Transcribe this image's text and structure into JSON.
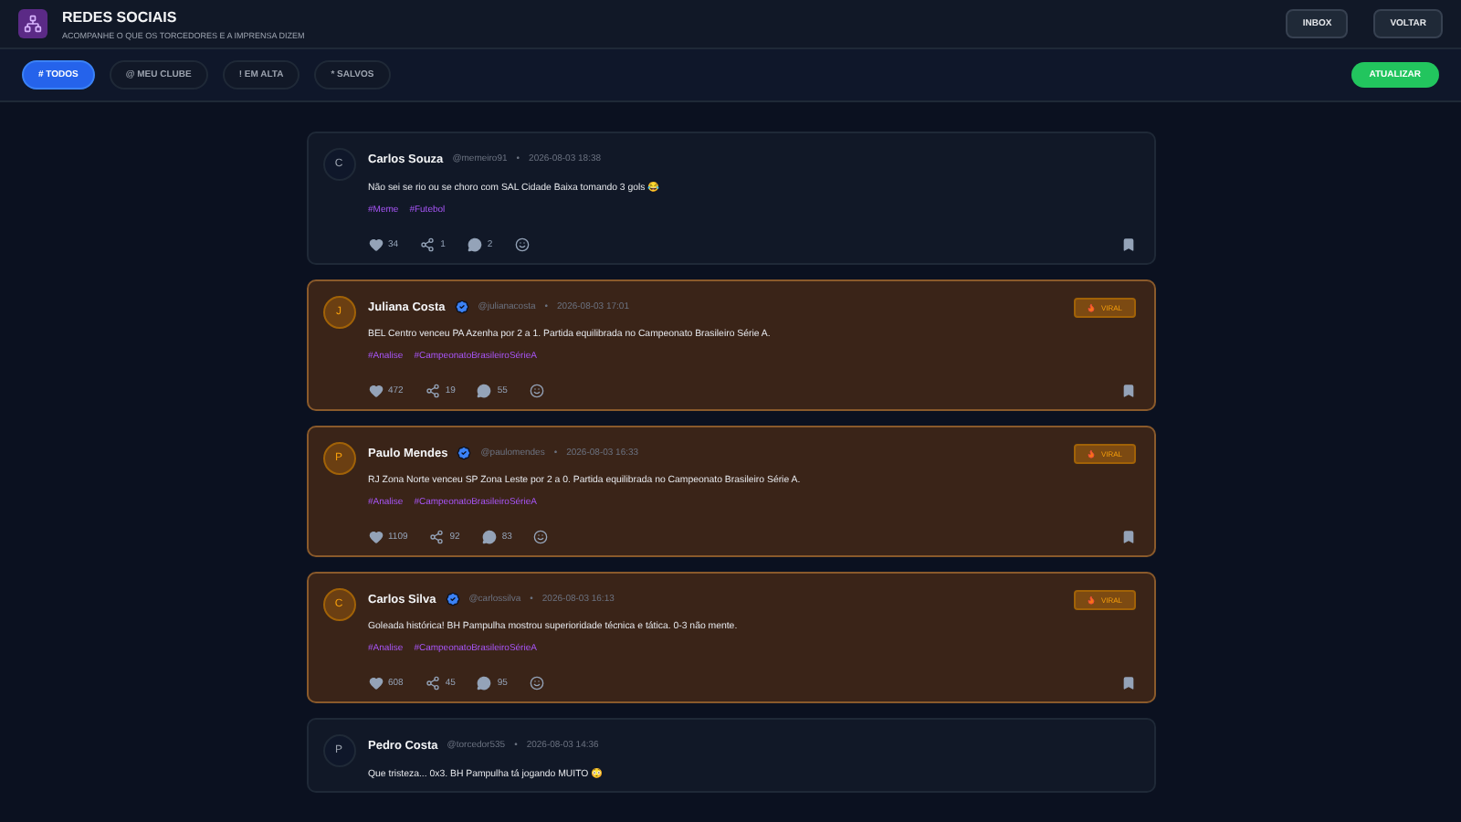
{
  "header": {
    "title": "REDES SOCIAIS",
    "subtitle": "ACOMPANHE O QUE OS TORCEDORES E A IMPRENSA DIZEM",
    "buttons": [
      "INBOX",
      "VOLTAR"
    ]
  },
  "filters": [
    {
      "label": "# TODOS",
      "selected": true
    },
    {
      "label": "@ MEU CLUBE",
      "selected": false
    },
    {
      "label": "! EM ALTA",
      "selected": false
    },
    {
      "label": "* SALVOS",
      "selected": false
    }
  ],
  "refresh_button": "ATUALIZAR",
  "posts": [
    {
      "avatar": "C",
      "name": "Carlos Souza",
      "verified": false,
      "handle": "@memeiro91",
      "separator": "•",
      "time": "2026-08-03 18:38",
      "viral": false,
      "text": "Não sei se rio ou se choro com SAL Cidade Baixa tomando 3 gols 😂",
      "tags": [
        "#Meme",
        "#Futebol"
      ],
      "likes": "34",
      "shares": "1",
      "comments": "2"
    },
    {
      "avatar": "J",
      "name": "Juliana Costa",
      "verified": true,
      "handle": "@julianacosta",
      "separator": "•",
      "time": "2026-08-03 17:01",
      "viral": true,
      "badge": "VIRAL",
      "text": "BEL Centro venceu PA Azenha por 2 a 1. Partida equilibrada no Campeonato Brasileiro Série A.",
      "tags": [
        "#Analise",
        "#CampeonatoBrasileiroSérieA"
      ],
      "likes": "472",
      "shares": "19",
      "comments": "55"
    },
    {
      "avatar": "P",
      "name": "Paulo Mendes",
      "verified": true,
      "handle": "@paulomendes",
      "separator": "•",
      "time": "2026-08-03 16:33",
      "viral": true,
      "badge": "VIRAL",
      "text": "RJ Zona Norte venceu SP Zona Leste por 2 a 0. Partida equilibrada no Campeonato Brasileiro Série A.",
      "tags": [
        "#Analise",
        "#CampeonatoBrasileiroSérieA"
      ],
      "likes": "1109",
      "shares": "92",
      "comments": "83"
    },
    {
      "avatar": "C",
      "name": "Carlos Silva",
      "verified": true,
      "handle": "@carlossilva",
      "separator": "•",
      "time": "2026-08-03 16:13",
      "viral": true,
      "badge": "VIRAL",
      "text": "Goleada histórica! BH Pampulha mostrou superioridade técnica e tática. 0-3 não mente.",
      "tags": [
        "#Analise",
        "#CampeonatoBrasileiroSérieA"
      ],
      "likes": "608",
      "shares": "45",
      "comments": "95"
    },
    {
      "avatar": "P",
      "name": "Pedro Costa",
      "verified": false,
      "handle": "@torcedor535",
      "separator": "•",
      "time": "2026-08-03 14:36",
      "viral": false,
      "text": "Que tristeza... 0x3. BH Pampulha tá jogando MUITO 😳"
    }
  ]
}
